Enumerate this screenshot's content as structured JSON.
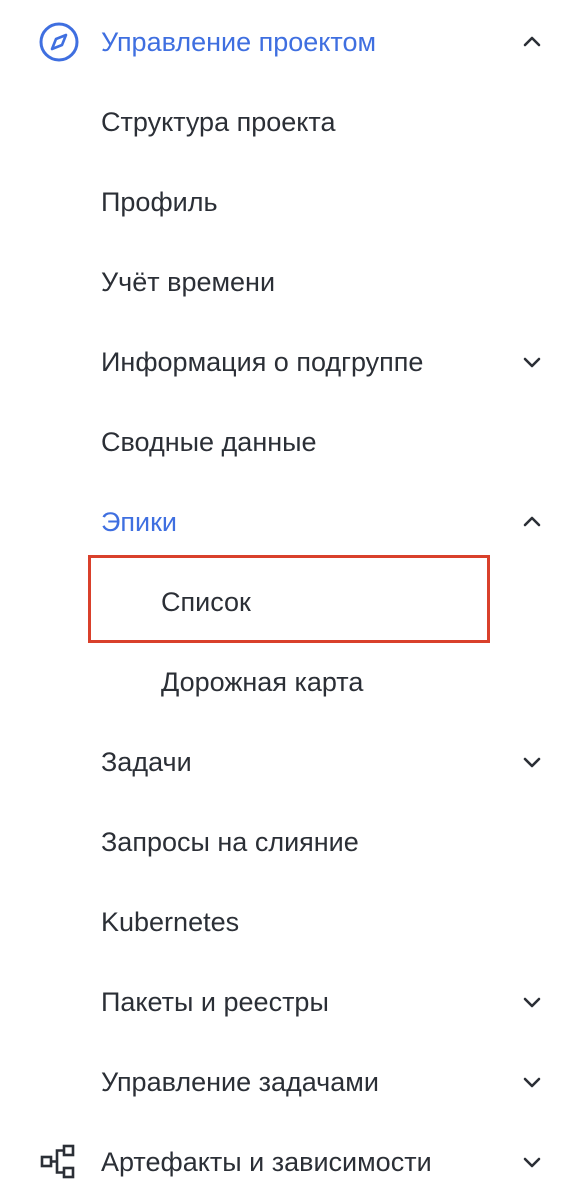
{
  "nav": {
    "project_management": {
      "label": "Управление проектом",
      "icon": "compass-icon",
      "state": "expanded",
      "accent_color": "#3f6fe0"
    },
    "items": [
      {
        "label": "Структура проекта"
      },
      {
        "label": "Профиль"
      },
      {
        "label": "Учёт времени"
      },
      {
        "label": "Информация о подгруппе",
        "state": "collapsed"
      },
      {
        "label": "Сводные данные"
      },
      {
        "label": "Эпики",
        "state": "expanded"
      },
      {
        "label": "Список",
        "highlighted": true
      },
      {
        "label": "Дорожная карта"
      },
      {
        "label": "Задачи",
        "state": "collapsed"
      },
      {
        "label": "Запросы на слияние"
      },
      {
        "label": "Kubernetes"
      },
      {
        "label": "Пакеты и реестры",
        "state": "collapsed"
      },
      {
        "label": "Управление задачами",
        "state": "collapsed"
      }
    ],
    "artifacts": {
      "label": "Артефакты и зависимости",
      "icon": "dependencies-icon",
      "state": "collapsed"
    }
  },
  "highlight_color": "#d9402b"
}
